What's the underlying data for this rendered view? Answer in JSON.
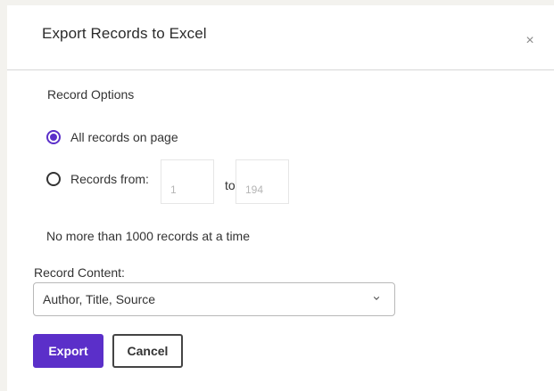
{
  "dialog": {
    "title": "Export Records to Excel",
    "close_label": "×"
  },
  "record_options": {
    "label": "Record Options",
    "options": [
      {
        "label": "All records on page",
        "selected": true
      },
      {
        "label": "Records from:",
        "selected": false
      }
    ],
    "range": {
      "from_placeholder": "1",
      "to_label": "to",
      "to_placeholder": "194"
    },
    "note": "No more than 1000 records at a time"
  },
  "record_content": {
    "label": "Record Content:",
    "selected": "Author, Title, Source"
  },
  "actions": {
    "export_label": "Export",
    "cancel_label": "Cancel"
  },
  "colors": {
    "accent": "#5b2fc9",
    "background": "#f3f2ee"
  },
  "icons": {
    "close": "close-icon",
    "dropdown": "chevron-down-icon"
  }
}
